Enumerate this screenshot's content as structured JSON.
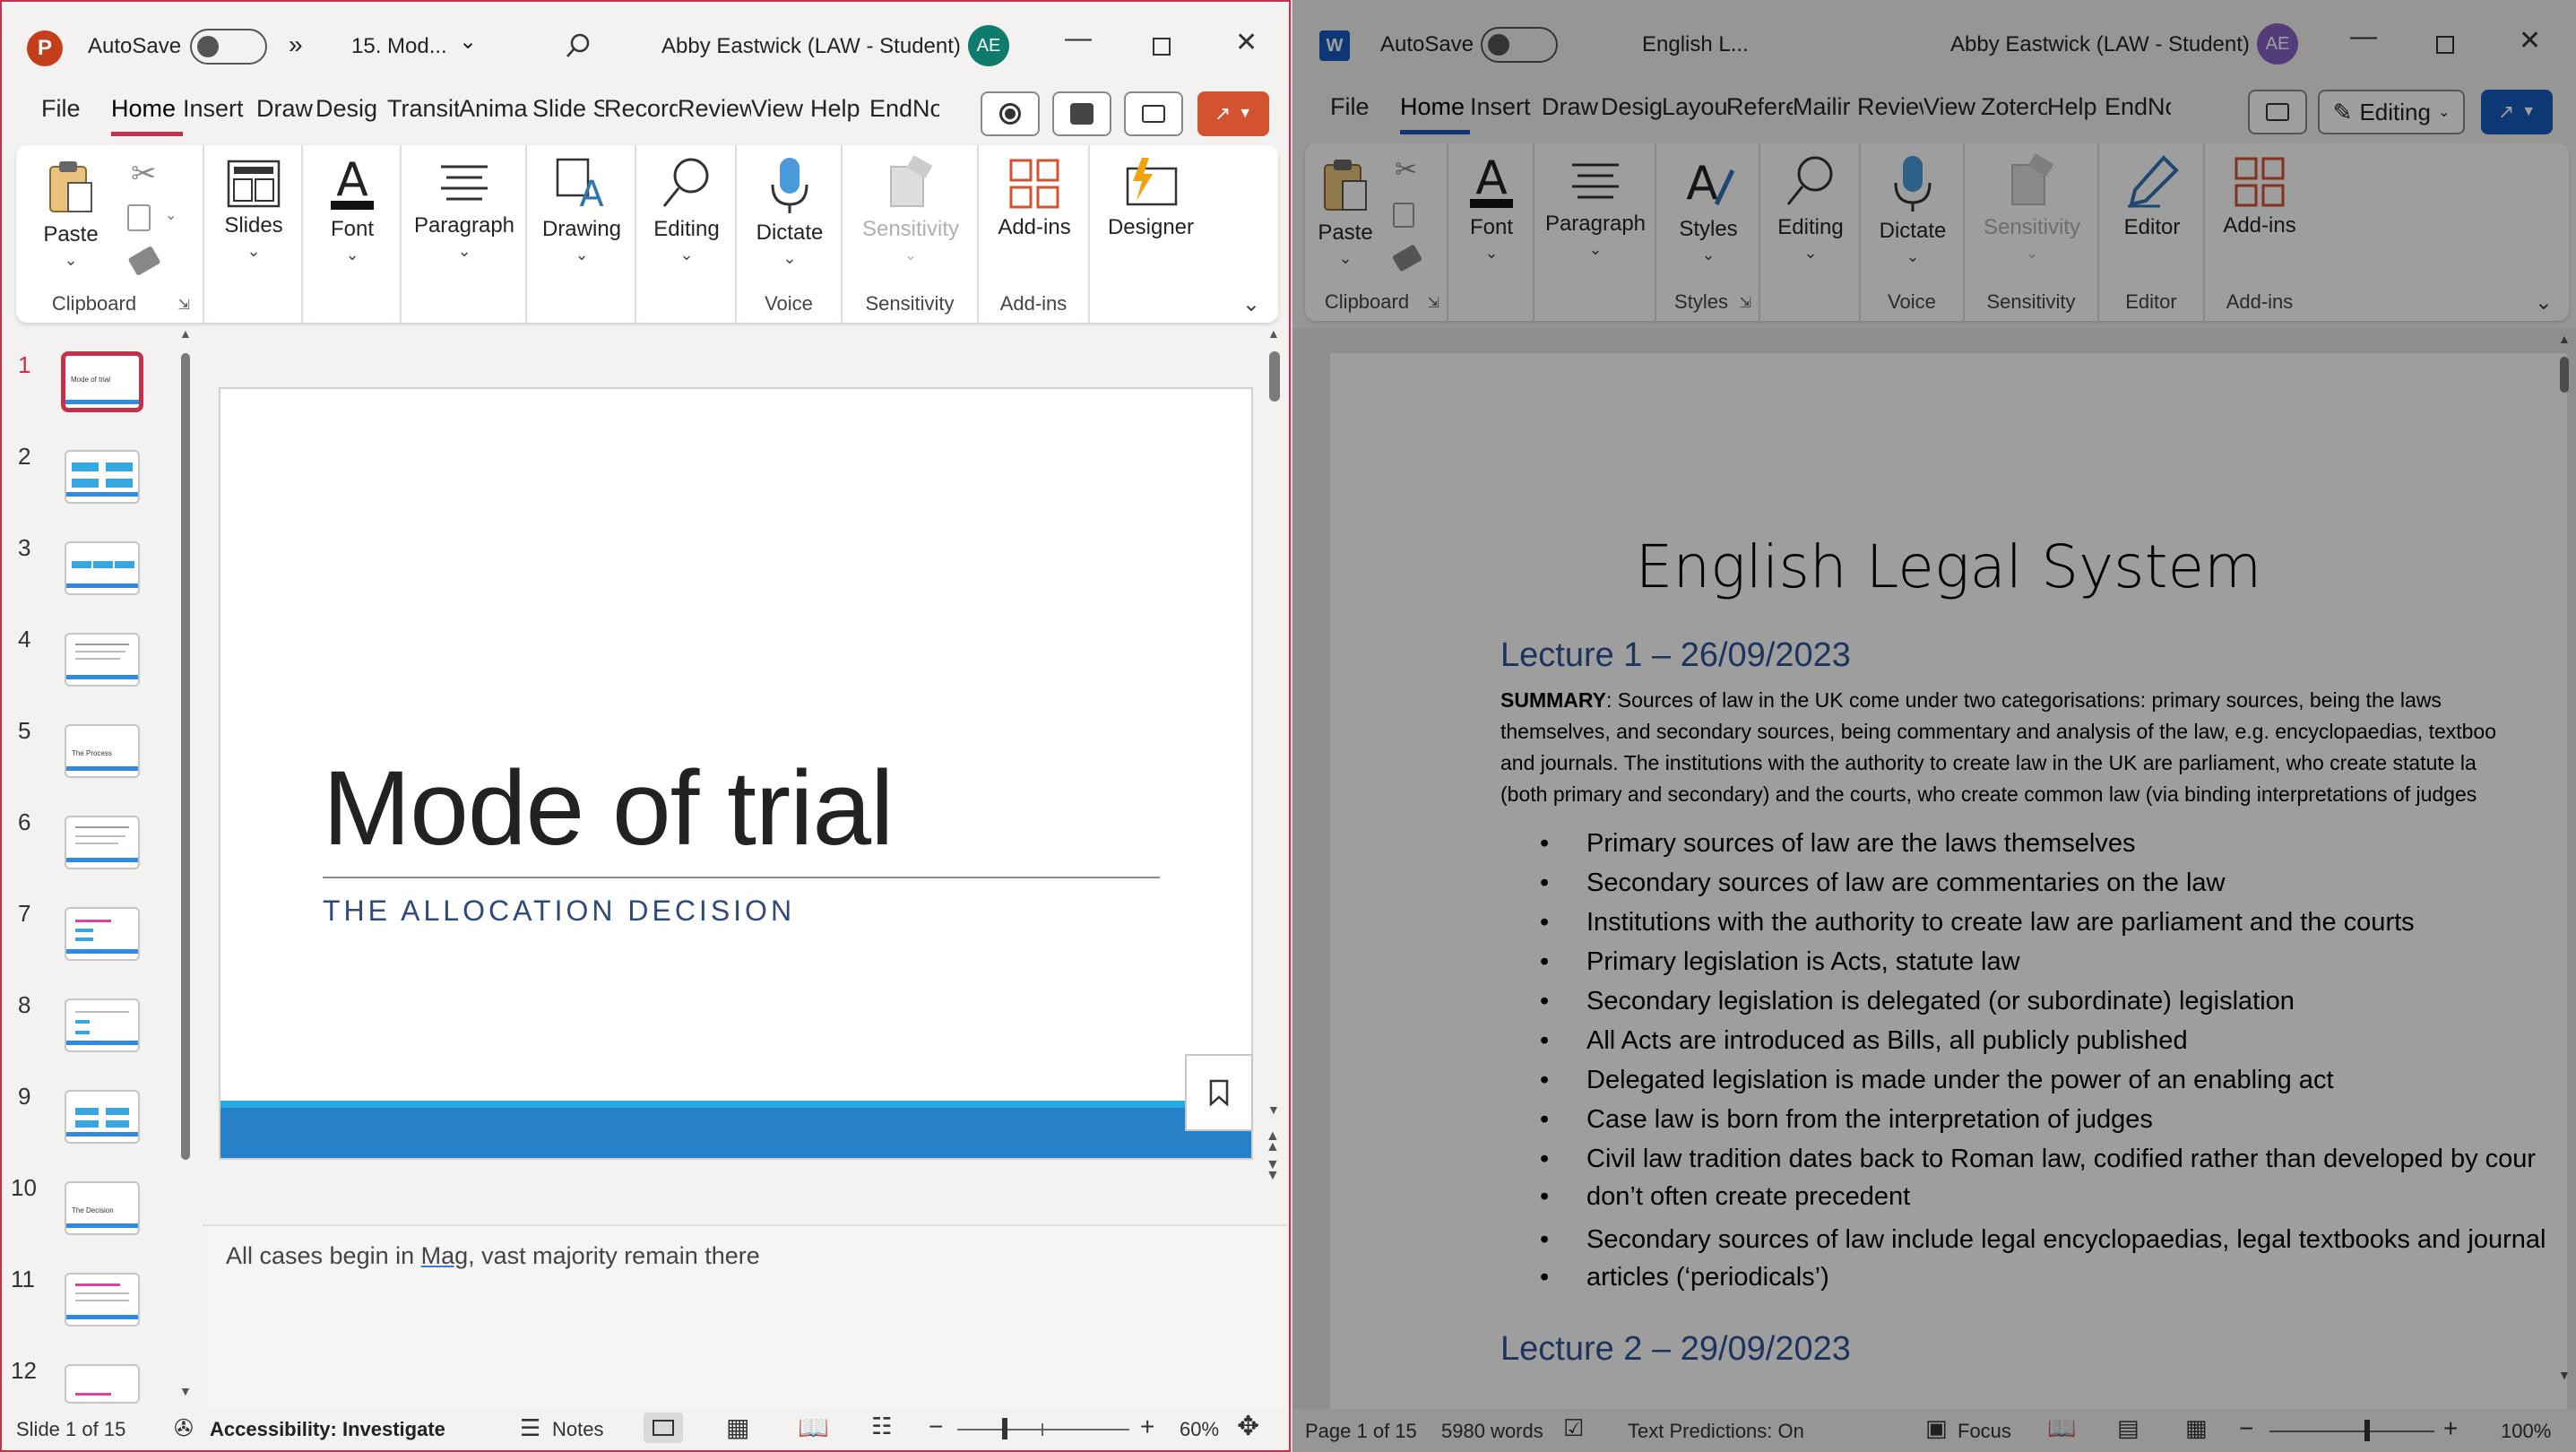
{
  "powerpoint": {
    "autosave_label": "AutoSave",
    "more_label": "»",
    "file_name": "15. Mod...",
    "user_name": "Abby Eastwick (LAW - Student)",
    "user_initials": "AE",
    "tabs": [
      "File",
      "Home",
      "Insert",
      "Draw",
      "Desig",
      "Transit",
      "Anima",
      "Slide S",
      "Record",
      "Review",
      "View",
      "Help",
      "EndNo"
    ],
    "active_tab": "Home",
    "ribbon": {
      "paste": "Paste",
      "clipboard_group": "Clipboard",
      "slides": "Slides",
      "font": "Font",
      "paragraph": "Paragraph",
      "drawing": "Drawing",
      "editing": "Editing",
      "dictate": "Dictate",
      "voice_group": "Voice",
      "sensitivity": "Sensitivity",
      "sensitivity_group": "Sensitivity",
      "addins": "Add-ins",
      "addins_group": "Add-ins",
      "designer": "Designer"
    },
    "thumbnails": [
      "1",
      "2",
      "3",
      "4",
      "5",
      "6",
      "7",
      "8",
      "9",
      "10",
      "11",
      "12"
    ],
    "thumb_titles": {
      "t1": "Mode of trial",
      "t5": "The Process",
      "t10": "The Decision"
    },
    "slide": {
      "title": "Mode of trial",
      "subtitle": "THE ALLOCATION DECISION"
    },
    "notes_text_a": "All cases begin in ",
    "notes_text_mag": "Mag",
    "notes_text_b": ", vast majority remain there",
    "status": {
      "slide_info": "Slide 1 of 15",
      "accessibility": "Accessibility: Investigate",
      "notes": "Notes",
      "zoom": "60%"
    },
    "colors": {
      "accent": "#c4314b",
      "slide_band": "#2681c8",
      "slide_band_light": "#27a9e1",
      "subtitle": "#2f4a7a"
    }
  },
  "word": {
    "autosave_label": "AutoSave",
    "file_name": "English L...",
    "user_name": "Abby Eastwick (LAW - Student)",
    "user_initials": "AE",
    "tabs": [
      "File",
      "Home",
      "Insert",
      "Draw",
      "Desig",
      "Layou",
      "Refere",
      "Mailir",
      "Review",
      "View",
      "Zotero",
      "Help",
      "EndNo"
    ],
    "active_tab": "Home",
    "editing_mode": "Editing",
    "ribbon": {
      "paste": "Paste",
      "clipboard_group": "Clipboard",
      "font": "Font",
      "paragraph": "Paragraph",
      "styles": "Styles",
      "styles_group": "Styles",
      "editing": "Editing",
      "dictate": "Dictate",
      "voice_group": "Voice",
      "sensitivity": "Sensitivity",
      "sensitivity_group": "Sensitivity",
      "editor": "Editor",
      "editor_group": "Editor",
      "addins": "Add-ins",
      "addins_group": "Add-ins"
    },
    "document": {
      "title": "English Legal System",
      "lecture1_heading": "Lecture 1 – 26/09/2023",
      "summary_label": "SUMMARY",
      "summary_lines": [
        ": Sources of law in the UK come under two categorisations: primary sources, being the laws",
        "themselves, and secondary sources, being commentary and analysis of the law, e.g. encyclopaedias, textboo",
        "and journals. The institutions with the authority to create law in the UK are parliament, who create statute la",
        "(both primary and secondary) and the courts, who create common law (via binding interpretations of judges"
      ],
      "bullets": [
        "Primary sources of law are the laws themselves",
        "Secondary sources of law are commentaries on the law",
        "Institutions with the authority to create law are parliament and the courts",
        "Primary legislation is Acts, statute law",
        "Secondary legislation is delegated (or subordinate) legislation",
        "All Acts are introduced as Bills, all publicly published",
        "Delegated legislation is made under the power of an enabling act",
        "Case law is born from the interpretation of judges",
        "Civil law tradition dates back to Roman law, codified rather than developed by cour",
        "don’t often create precedent",
        "Secondary sources of law include legal encyclopaedias, legal textbooks and journal",
        "articles (‘periodicals’)"
      ],
      "lecture2_heading": "Lecture 2 – 29/09/2023"
    },
    "status": {
      "page_info": "Page 1 of 15",
      "word_count": "5980 words",
      "text_predictions": "Text Predictions: On",
      "focus": "Focus",
      "zoom": "100%"
    }
  }
}
